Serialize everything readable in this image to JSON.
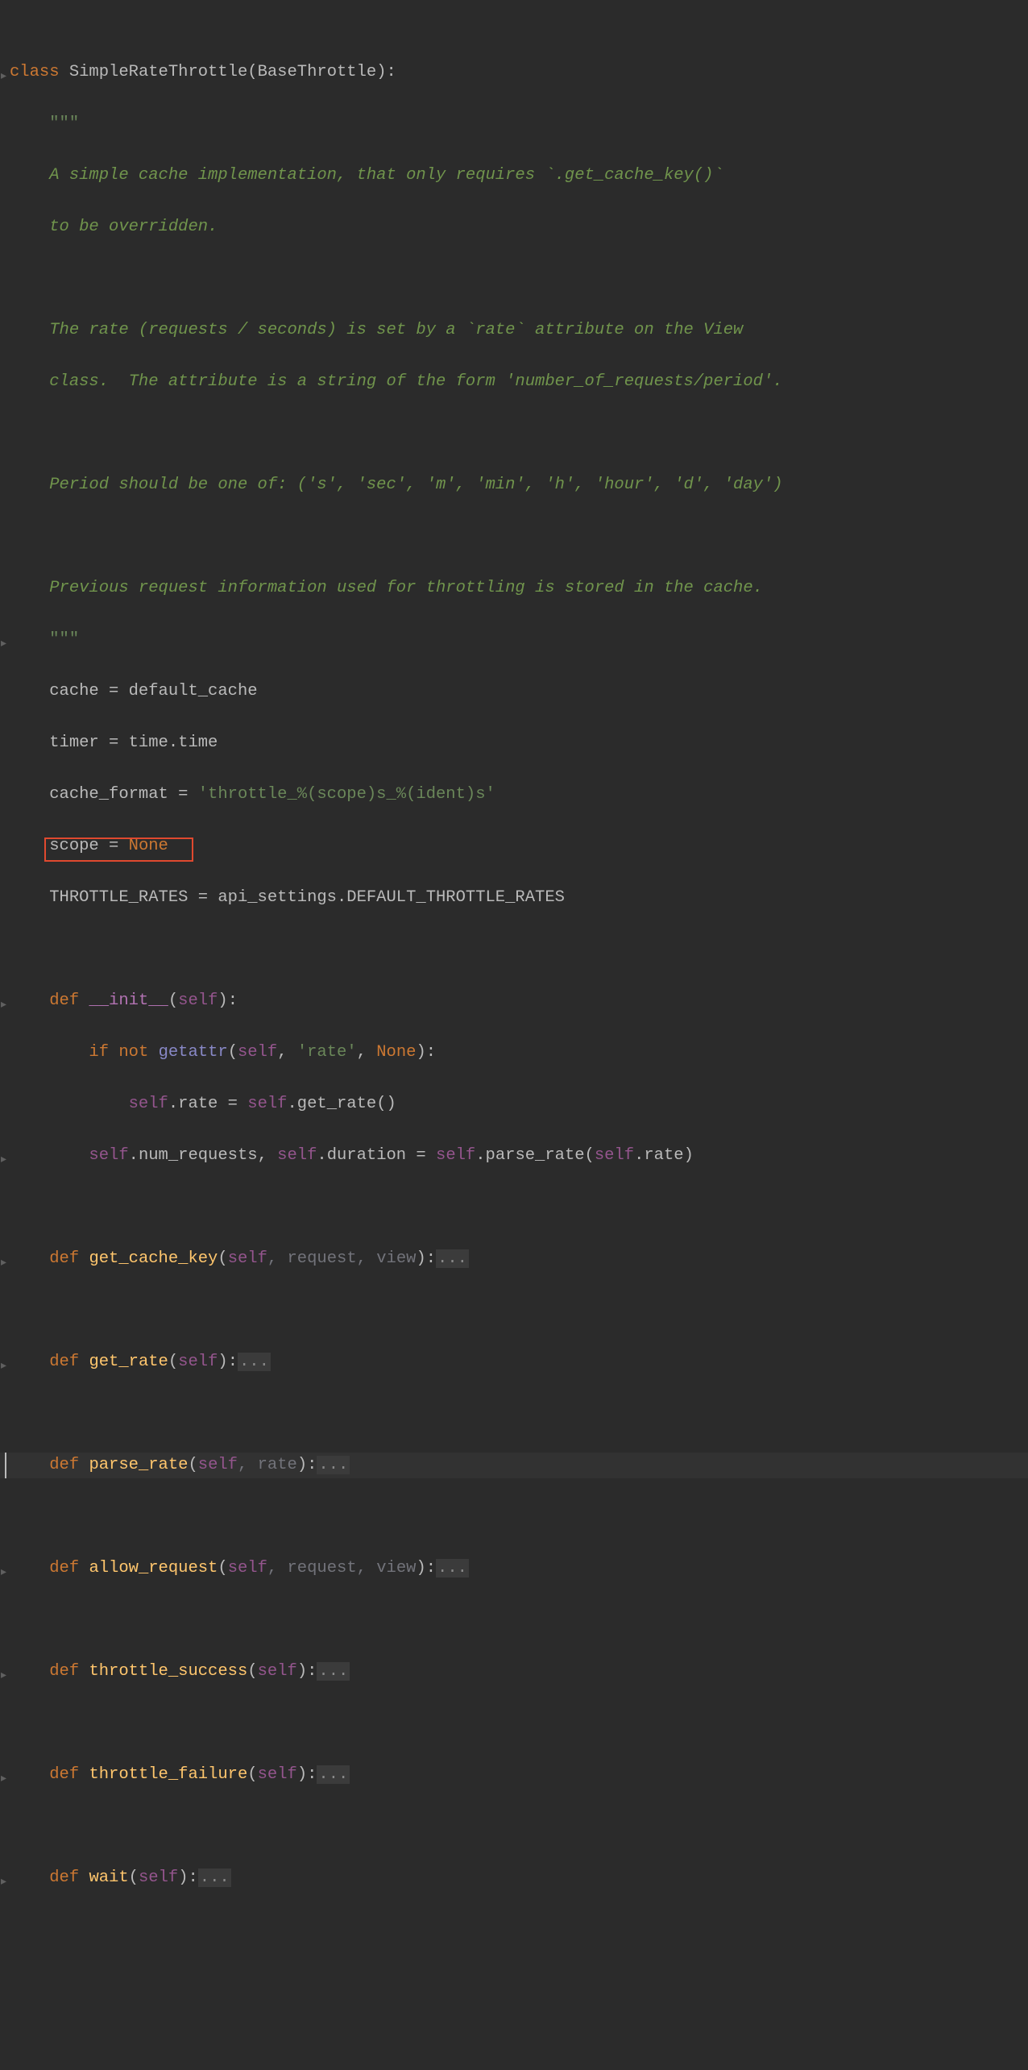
{
  "colors": {
    "background": "#2b2b2b",
    "keyword": "#cc7832",
    "function": "#ffc66d",
    "dunder": "#b373b3",
    "self": "#94558d",
    "param": "#72737a",
    "string": "#6a8759",
    "doc": "#70944c",
    "default": "#bababa",
    "builtin": "#8888c6",
    "highlight_border": "#e0492f"
  },
  "lines": {
    "l1": {
      "kw_class": "class",
      "cls": "SimpleRateThrottle",
      "lp": "(",
      "base": "BaseThrottle",
      "rp": "):"
    },
    "l2": {
      "doc": "\"\"\""
    },
    "l3": {
      "doc": "A simple cache implementation, that only requires `.get_cache_key()`"
    },
    "l4": {
      "doc": "to be overridden."
    },
    "l5": {
      "doc": ""
    },
    "l6": {
      "doc": "The rate (requests / seconds) is set by a `rate` attribute on the View"
    },
    "l7": {
      "doc": "class.  The attribute is a string of the form 'number_of_requests/period'."
    },
    "l8": {
      "doc": ""
    },
    "l9": {
      "doc": "Period should be one of: ('s', 'sec', 'm', 'min', 'h', 'hour', 'd', 'day')"
    },
    "l10": {
      "doc": ""
    },
    "l11": {
      "doc": "Previous request information used for throttling is stored in the cache."
    },
    "l12": {
      "doc": "\"\"\""
    },
    "l13": {
      "a": "cache = default_cache"
    },
    "l14": {
      "a": "timer = time.time"
    },
    "l15": {
      "lhs": "cache_format = ",
      "str": "'throttle_%(scope)s_%(ident)s'"
    },
    "l16": {
      "lhs": "scope = ",
      "none": "None"
    },
    "l17": {
      "a": "THROTTLE_RATES = api_settings.DEFAULT_THROTTLE_RATES"
    },
    "l18": {
      "a": ""
    },
    "l19": {
      "kw": "def",
      "fn": "__init__",
      "sig_open": "(",
      "self": "self",
      "sig_close": "):"
    },
    "l20": {
      "if": "if",
      "not": "not",
      "builtin": "getattr",
      "lp": "(",
      "self": "self",
      "c1": ", ",
      "str": "'rate'",
      "c2": ", ",
      "none": "None",
      "rp": "):"
    },
    "l21": {
      "self": "self",
      "dot": ".rate = ",
      "self2": "self",
      "call": ".get_rate()"
    },
    "l22": {
      "self1": "self",
      "p1": ".num_requests, ",
      "self2": "self",
      "p2": ".duration = ",
      "self3": "self",
      "p3": ".parse_rate(",
      "self4": "self",
      "p4": ".rate)"
    },
    "l23": {
      "a": ""
    },
    "l24": {
      "kw": "def",
      "fn": "get_cache_key",
      "sig_open": "(",
      "self": "self",
      "params": ", request, view",
      "sig_close": "):",
      "fold": "..."
    },
    "l25": {
      "a": ""
    },
    "l26": {
      "kw": "def",
      "fn": "get_rate",
      "sig_open": "(",
      "self": "self",
      "sig_close": "):",
      "fold": "..."
    },
    "l27": {
      "a": ""
    },
    "l28": {
      "kw": "def",
      "fn": "parse_rate",
      "sig_open": "(",
      "self": "self",
      "params": ", rate",
      "sig_close": "):",
      "fold": "..."
    },
    "l29": {
      "a": ""
    },
    "l30": {
      "kw": "def",
      "fn": "allow_request",
      "sig_open": "(",
      "self": "self",
      "params": ", request, view",
      "sig_close": "):",
      "fold": "..."
    },
    "l31": {
      "a": ""
    },
    "l32": {
      "kw": "def",
      "fn": "throttle_success",
      "sig_open": "(",
      "self": "self",
      "sig_close": "):",
      "fold": "..."
    },
    "l33": {
      "a": ""
    },
    "l34": {
      "kw": "def",
      "fn": "throttle_failure",
      "sig_open": "(",
      "self": "self",
      "sig_close": "):",
      "fold": "..."
    },
    "l35": {
      "a": ""
    },
    "l36": {
      "kw": "def",
      "fn": "wait",
      "sig_open": "(",
      "self": "self",
      "sig_close": "):",
      "fold": "..."
    }
  }
}
